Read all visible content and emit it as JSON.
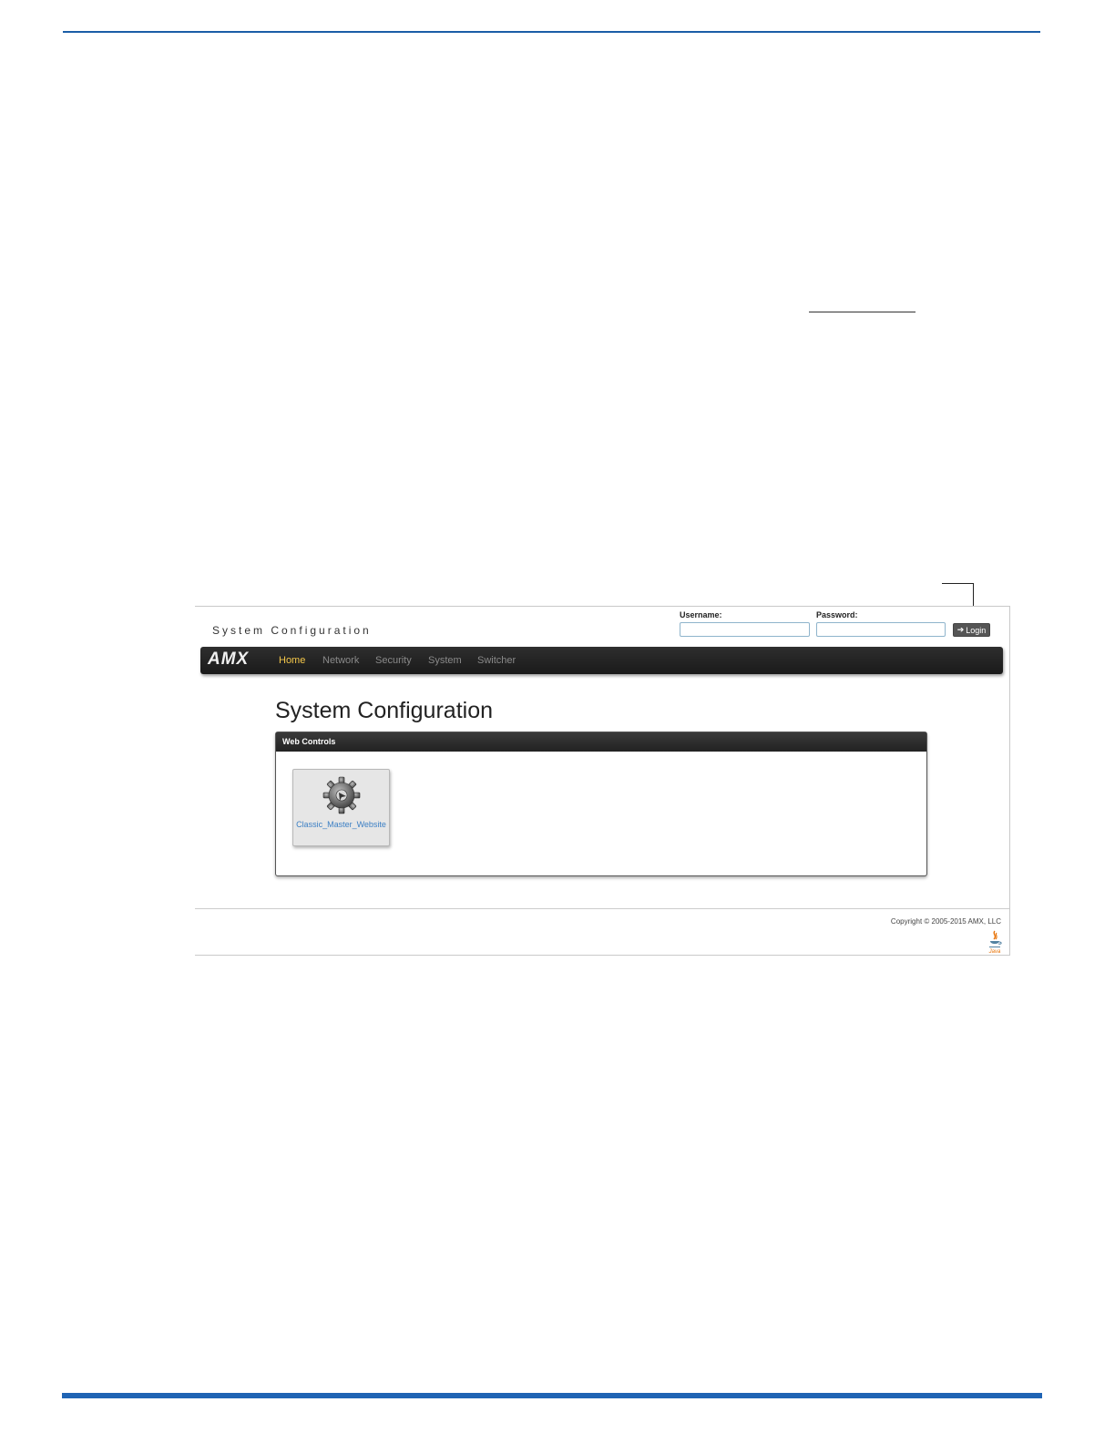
{
  "site": {
    "title": "System Configuration"
  },
  "login": {
    "username_label": "Username:",
    "password_label": "Password:",
    "username_value": "",
    "password_value": "",
    "button_label": "Login"
  },
  "nav": {
    "brand": "AMX",
    "items": [
      {
        "label": "Home",
        "active": true
      },
      {
        "label": "Network",
        "active": false
      },
      {
        "label": "Security",
        "active": false
      },
      {
        "label": "System",
        "active": false
      },
      {
        "label": "Switcher",
        "active": false
      }
    ]
  },
  "main": {
    "title": "System Configuration",
    "panel": {
      "header": "Web Controls",
      "tiles": [
        {
          "label": "Classic_Master_Website",
          "icon": "gear-icon"
        }
      ]
    }
  },
  "footer": {
    "copyright": "Copyright © 2005-2015 AMX, LLC",
    "icon": "java-icon"
  },
  "colors": {
    "doc_rule": "#1f64b4",
    "nav_active": "#f5c84a",
    "link": "#3b7fc4"
  }
}
